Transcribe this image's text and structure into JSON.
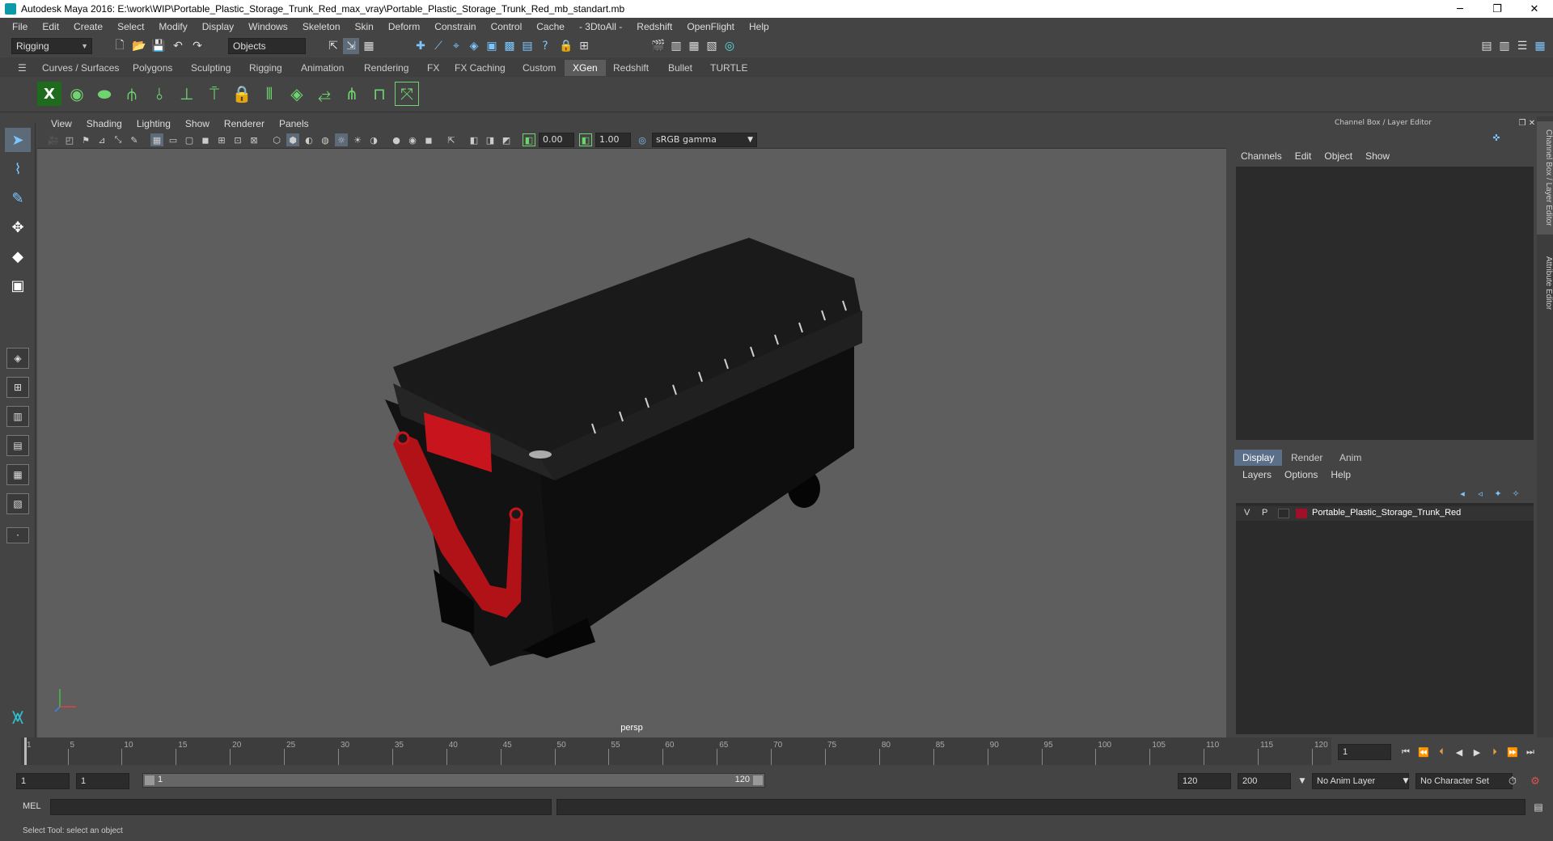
{
  "window": {
    "title": "Autodesk Maya 2016: E:\\work\\WIP\\Portable_Plastic_Storage_Trunk_Red_max_vray\\Portable_Plastic_Storage_Trunk_Red_mb_standart.mb",
    "minimize": "─",
    "restore": "❐",
    "close": "✕"
  },
  "menubar": [
    "File",
    "Edit",
    "Create",
    "Select",
    "Modify",
    "Display",
    "Windows",
    "Skeleton",
    "Skin",
    "Deform",
    "Constrain",
    "Control",
    "Cache",
    "- 3DtoAll -",
    "Redshift",
    "OpenFlight",
    "Help"
  ],
  "statusline": {
    "mode": "Rigging",
    "selection_mode": "Objects"
  },
  "shelf": {
    "tabs": [
      "Curves / Surfaces",
      "Polygons",
      "Sculpting",
      "Rigging",
      "Animation",
      "Rendering",
      "FX",
      "FX Caching",
      "Custom",
      "XGen",
      "Redshift",
      "Bullet",
      "TURTLE"
    ],
    "active_tab": "XGen"
  },
  "viewport": {
    "menu": [
      "View",
      "Shading",
      "Lighting",
      "Show",
      "Renderer",
      "Panels"
    ],
    "exposure": "0.00",
    "gamma": "1.00",
    "color_space": "sRGB gamma",
    "camera": "persp"
  },
  "channel_box": {
    "title": "Channel Box / Layer Editor",
    "menu": [
      "Channels",
      "Edit",
      "Object",
      "Show"
    ]
  },
  "layer_editor": {
    "tabs": [
      "Display",
      "Render",
      "Anim"
    ],
    "active_tab": "Display",
    "menu": [
      "Layers",
      "Options",
      "Help"
    ],
    "layers": [
      {
        "visible": "V",
        "playback": "P",
        "name": "Portable_Plastic_Storage_Trunk_Red",
        "color": "#a0102a"
      }
    ]
  },
  "side_tabs": [
    "Channel Box / Layer Editor",
    "Attribute Editor"
  ],
  "timeline": {
    "ticks": [
      1,
      5,
      10,
      15,
      20,
      25,
      30,
      35,
      40,
      45,
      50,
      55,
      60,
      65,
      70,
      75,
      80,
      85,
      90,
      95,
      100,
      105,
      110,
      115,
      120
    ],
    "current_frame": "1"
  },
  "range": {
    "start": "1",
    "anim_start": "1",
    "range_start_label": "1",
    "range_end_label": "120",
    "end": "120",
    "anim_end": "200",
    "anim_layer": "No Anim Layer",
    "character_set": "No Character Set"
  },
  "command_line": {
    "label": "MEL"
  },
  "help_line": {
    "text": "Select Tool: select an object"
  }
}
